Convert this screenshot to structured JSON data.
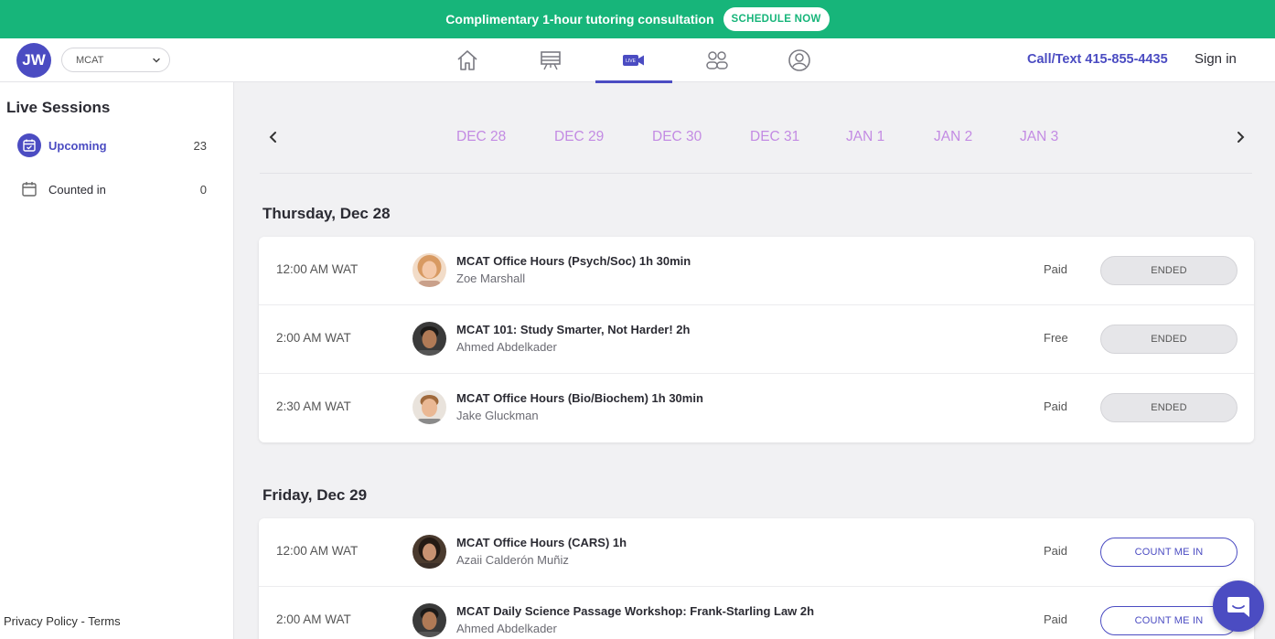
{
  "banner": {
    "text": "Complimentary 1-hour tutoring consultation",
    "button": "SCHEDULE NOW"
  },
  "header": {
    "avatar_initials": "JW",
    "exam_select": "MCAT",
    "live_icon_label": "LIVE",
    "phone": "Call/Text 415-855-4435",
    "signin": "Sign in"
  },
  "sidebar": {
    "title": "Live Sessions",
    "items": [
      {
        "label": "Upcoming",
        "count": "23"
      },
      {
        "label": "Counted in",
        "count": "0"
      }
    ],
    "footer": "Privacy Policy - Terms"
  },
  "datebar": {
    "dates": [
      "DEC 28",
      "DEC 29",
      "DEC 30",
      "DEC 31",
      "JAN 1",
      "JAN 2",
      "JAN 3"
    ]
  },
  "days": [
    {
      "heading": "Thursday, Dec 28",
      "sessions": [
        {
          "time": "12:00 AM WAT",
          "title": "MCAT Office Hours (Psych/Soc) 1h 30min",
          "tutor": "Zoe Marshall",
          "price": "Paid",
          "status": "ENDED"
        },
        {
          "time": "2:00 AM WAT",
          "title": "MCAT 101: Study Smarter, Not Harder! 2h",
          "tutor": "Ahmed Abdelkader",
          "price": "Free",
          "status": "ENDED"
        },
        {
          "time": "2:30 AM WAT",
          "title": "MCAT Office Hours (Bio/Biochem) 1h 30min",
          "tutor": "Jake Gluckman",
          "price": "Paid",
          "status": "ENDED"
        }
      ]
    },
    {
      "heading": "Friday, Dec 29",
      "sessions": [
        {
          "time": "12:00 AM WAT",
          "title": "MCAT Office Hours (CARS) 1h",
          "tutor": "Azaii Calderón Muñiz",
          "price": "Paid",
          "status": "COUNT ME IN"
        },
        {
          "time": "2:00 AM WAT",
          "title": "MCAT Daily Science Passage Workshop: Frank-Starling Law 2h",
          "tutor": "Ahmed Abdelkader",
          "price": "Paid",
          "status": "COUNT ME IN"
        }
      ]
    }
  ],
  "colors": {
    "brand": "#4b4cc2",
    "banner": "#17b57a",
    "date_text": "#c38be3"
  }
}
